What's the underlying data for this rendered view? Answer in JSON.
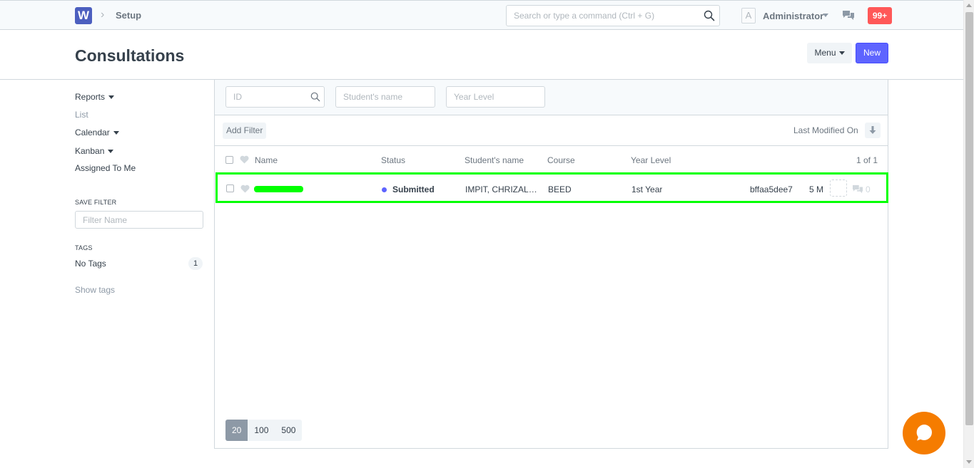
{
  "navbar": {
    "brand_letter": "W",
    "breadcrumb": "Setup",
    "search_placeholder": "Search or type a command (Ctrl + G)",
    "avatar_letter": "A",
    "user_name": "Administrator",
    "notification_count": "99+"
  },
  "page": {
    "title": "Consultations",
    "menu_label": "Menu",
    "new_label": "New"
  },
  "sidebar": {
    "links": [
      "Reports",
      "List",
      "Calendar",
      "Kanban",
      "Assigned To Me"
    ],
    "save_filter_heading": "SAVE FILTER",
    "filter_name_placeholder": "Filter Name",
    "tags_heading": "TAGS",
    "no_tags_label": "No Tags",
    "no_tags_count": "1",
    "show_tags_label": "Show tags"
  },
  "filters": {
    "id_placeholder": "ID",
    "student_name_placeholder": "Student's name",
    "year_level_placeholder": "Year Level",
    "add_filter_label": "Add Filter",
    "sort_label": "Last Modified On"
  },
  "list": {
    "columns": {
      "name": "Name",
      "status": "Status",
      "student_name": "Student's name",
      "course": "Course",
      "year_level": "Year Level"
    },
    "count_label": "1 of 1",
    "rows": [
      {
        "status": "Submitted",
        "student_name": "IMPIT, CHRIZALE ...",
        "course": "BEED",
        "year_level": "1st Year",
        "id": "bffaa5dee7",
        "modified": "5 M",
        "comments": "0"
      }
    ]
  },
  "paging": {
    "options": [
      "20",
      "100",
      "500"
    ]
  },
  "colors": {
    "primary": "#5e64ff",
    "highlight": "#00ff00",
    "notification": "#ff5858",
    "chat": "#f57c00"
  }
}
